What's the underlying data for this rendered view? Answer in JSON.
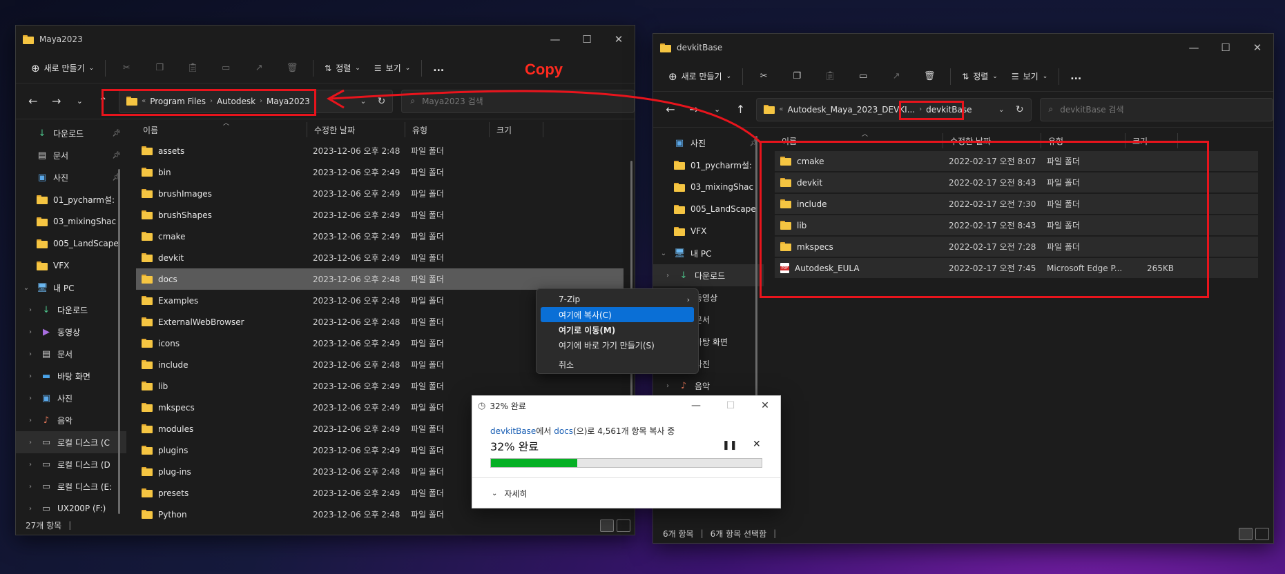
{
  "left_window": {
    "title": "Maya2023",
    "toolbar": {
      "new_label": "새로 만들기",
      "sort_label": "정렬",
      "view_label": "보기",
      "more_label": "..."
    },
    "breadcrumb": [
      "Program Files",
      "Autodesk",
      "Maya2023"
    ],
    "search_placeholder": "Maya2023 검색",
    "columns": {
      "name": "이름",
      "modified": "수정한 날짜",
      "type": "유형",
      "size": "크기"
    },
    "sidebar": [
      {
        "label": "다운로드",
        "icon": "download-icon",
        "pinned": true
      },
      {
        "label": "문서",
        "icon": "document-icon",
        "pinned": true
      },
      {
        "label": "사진",
        "icon": "picture-icon",
        "pinned": true
      },
      {
        "label": "01_pycharm설:",
        "icon": "folder-icon",
        "pinned": false
      },
      {
        "label": "03_mixingShac",
        "icon": "folder-icon",
        "pinned": false
      },
      {
        "label": "005_LandScape",
        "icon": "folder-icon",
        "pinned": false
      },
      {
        "label": "VFX",
        "icon": "folder-icon",
        "pinned": false
      },
      {
        "label": "내 PC",
        "icon": "pc-icon",
        "pinned": false
      },
      {
        "label": "다운로드",
        "icon": "download-icon",
        "pinned": false
      },
      {
        "label": "동영상",
        "icon": "video-icon",
        "pinned": false
      },
      {
        "label": "문서",
        "icon": "document-icon",
        "pinned": false
      },
      {
        "label": "바탕 화면",
        "icon": "desktop-icon",
        "pinned": false
      },
      {
        "label": "사진",
        "icon": "picture-icon",
        "pinned": false
      },
      {
        "label": "음악",
        "icon": "music-icon",
        "pinned": false
      },
      {
        "label": "로컬 디스크 (C",
        "icon": "drive-icon",
        "pinned": false
      },
      {
        "label": "로컬 디스크 (D",
        "icon": "drive-icon",
        "pinned": false
      },
      {
        "label": "로컬 디스크 (E:",
        "icon": "drive-icon",
        "pinned": false
      },
      {
        "label": "UX200P (F:)",
        "icon": "drive-icon",
        "pinned": false
      }
    ],
    "rows": [
      {
        "name": "assets",
        "modified": "2023-12-06 오후 2:48",
        "type": "파일 폴더"
      },
      {
        "name": "bin",
        "modified": "2023-12-06 오후 2:49",
        "type": "파일 폴더"
      },
      {
        "name": "brushImages",
        "modified": "2023-12-06 오후 2:49",
        "type": "파일 폴더"
      },
      {
        "name": "brushShapes",
        "modified": "2023-12-06 오후 2:49",
        "type": "파일 폴더"
      },
      {
        "name": "cmake",
        "modified": "2023-12-06 오후 2:49",
        "type": "파일 폴더"
      },
      {
        "name": "devkit",
        "modified": "2023-12-06 오후 2:49",
        "type": "파일 폴더"
      },
      {
        "name": "docs",
        "modified": "2023-12-06 오후 2:48",
        "type": "파일 폴더"
      },
      {
        "name": "Examples",
        "modified": "2023-12-06 오후 2:48",
        "type": "파일 폴더"
      },
      {
        "name": "ExternalWebBrowser",
        "modified": "2023-12-06 오후 2:48",
        "type": "파일 폴더"
      },
      {
        "name": "icons",
        "modified": "2023-12-06 오후 2:49",
        "type": "파일 폴더"
      },
      {
        "name": "include",
        "modified": "2023-12-06 오후 2:48",
        "type": "파일 폴더"
      },
      {
        "name": "lib",
        "modified": "2023-12-06 오후 2:49",
        "type": "파일 폴더"
      },
      {
        "name": "mkspecs",
        "modified": "2023-12-06 오후 2:49",
        "type": "파일 폴더"
      },
      {
        "name": "modules",
        "modified": "2023-12-06 오후 2:49",
        "type": "파일 폴더"
      },
      {
        "name": "plugins",
        "modified": "2023-12-06 오후 2:49",
        "type": "파일 폴더"
      },
      {
        "name": "plug-ins",
        "modified": "2023-12-06 오후 2:48",
        "type": "파일 폴더"
      },
      {
        "name": "presets",
        "modified": "2023-12-06 오후 2:49",
        "type": "파일 폴더"
      },
      {
        "name": "Python",
        "modified": "2023-12-06 오후 2:48",
        "type": "파일 폴더"
      }
    ],
    "status": "27개 항목"
  },
  "right_window": {
    "title": "devkitBase",
    "toolbar": {
      "new_label": "새로 만들기",
      "sort_label": "정렬",
      "view_label": "보기",
      "more_label": "..."
    },
    "breadcrumb": [
      "Autodesk_Maya_2023_DEVKI...",
      "devkitBase"
    ],
    "search_placeholder": "devkitBase 검색",
    "columns": {
      "name": "이름",
      "modified": "수정한 날짜",
      "type": "유형",
      "size": "크기"
    },
    "sidebar": [
      {
        "label": "사진",
        "icon": "picture-icon",
        "pinned": true
      },
      {
        "label": "01_pycharm설:",
        "icon": "folder-icon",
        "pinned": false
      },
      {
        "label": "03_mixingShac",
        "icon": "folder-icon",
        "pinned": false
      },
      {
        "label": "005_LandScape",
        "icon": "folder-icon",
        "pinned": false
      },
      {
        "label": "VFX",
        "icon": "folder-icon",
        "pinned": false
      },
      {
        "label": "내 PC",
        "icon": "pc-icon",
        "pinned": false
      },
      {
        "label": "다운로드",
        "icon": "download-icon",
        "pinned": false
      },
      {
        "label": "동영상",
        "icon": "video-icon",
        "pinned": false
      },
      {
        "label": "문서",
        "icon": "document-icon",
        "pinned": false
      },
      {
        "label": "바탕 화면",
        "icon": "desktop-icon",
        "pinned": false
      },
      {
        "label": "사진",
        "icon": "picture-icon",
        "pinned": false
      },
      {
        "label": "음악",
        "icon": "music-icon",
        "pinned": false
      }
    ],
    "rows": [
      {
        "name": "cmake",
        "modified": "2022-02-17 오전 8:07",
        "type": "파일 폴더",
        "size": ""
      },
      {
        "name": "devkit",
        "modified": "2022-02-17 오전 8:43",
        "type": "파일 폴더",
        "size": ""
      },
      {
        "name": "include",
        "modified": "2022-02-17 오전 7:30",
        "type": "파일 폴더",
        "size": ""
      },
      {
        "name": "lib",
        "modified": "2022-02-17 오전 8:43",
        "type": "파일 폴더",
        "size": ""
      },
      {
        "name": "mkspecs",
        "modified": "2022-02-17 오전 7:28",
        "type": "파일 폴더",
        "size": ""
      },
      {
        "name": "Autodesk_EULA",
        "modified": "2022-02-17 오전 7:45",
        "type": "Microsoft Edge P...",
        "size": "265KB"
      }
    ],
    "status_count": "6개 항목",
    "status_selected": "6개 항목 선택함"
  },
  "context_menu": {
    "items": [
      "7-Zip",
      "여기에 복사(C)",
      "여기로 이동(M)",
      "여기에 바로 가기 만들기(S)",
      "취소"
    ]
  },
  "copy_dialog": {
    "title": "32% 완료",
    "source": "devkitBase",
    "mid1": "에서 ",
    "dest": "docs",
    "mid2": "(으)로 4,561개 항목 복사 중",
    "percent_text": "32% 완료",
    "progress": 0.32,
    "details_label": "자세히"
  },
  "annotation": {
    "label": "Copy",
    "color": "#e8141c"
  }
}
